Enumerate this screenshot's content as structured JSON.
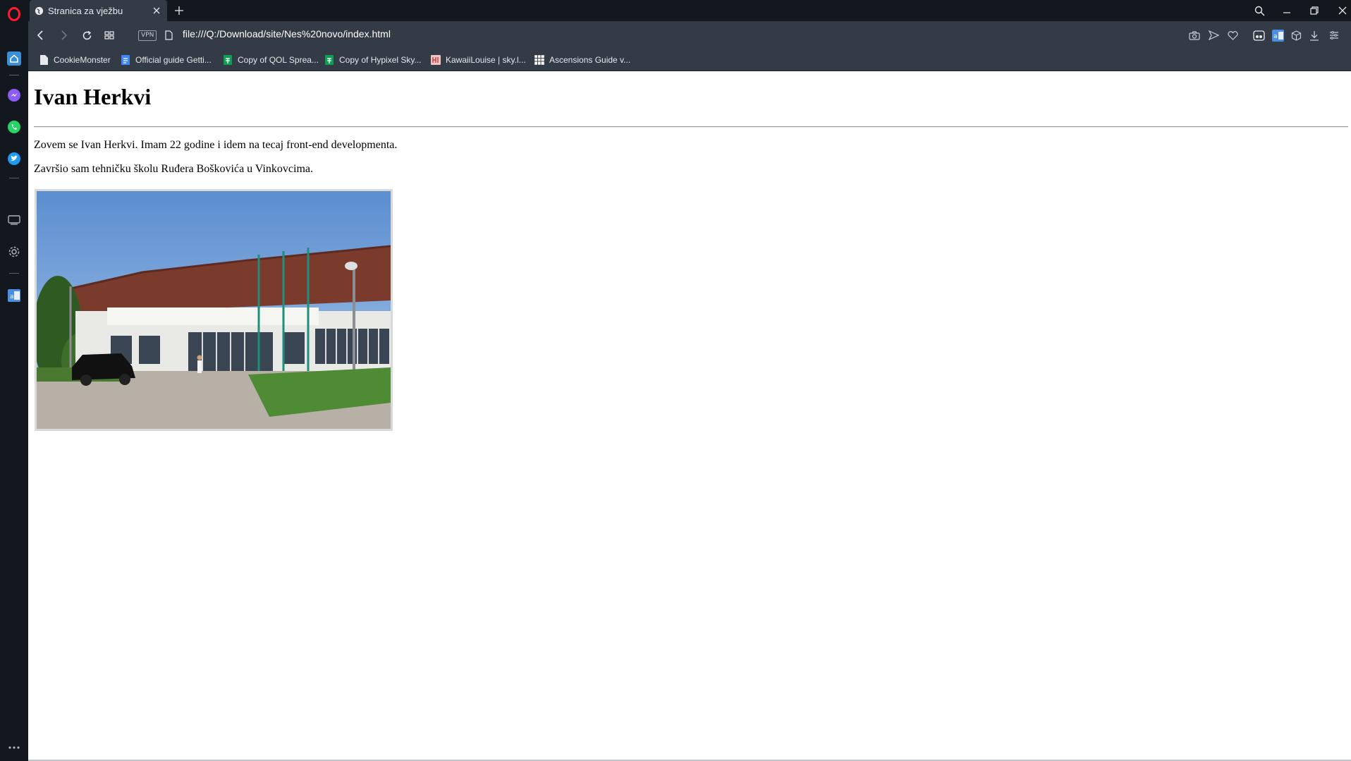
{
  "tab": {
    "title": "Stranica za vježbu"
  },
  "toolbar": {
    "vpn_label": "VPN",
    "url": "file:///Q:/Download/site/Nes%20novo/index.html"
  },
  "bookmarks": [
    {
      "label": "CookieMonster",
      "icon": "page-icon"
    },
    {
      "label": "Official guide Getti...",
      "icon": "docs-icon"
    },
    {
      "label": "Copy of QOL Sprea...",
      "icon": "sheets-icon"
    },
    {
      "label": "Copy of Hypixel Sky...",
      "icon": "sheets-icon"
    },
    {
      "label": "KawaiiLouise | sky.l...",
      "icon": "site-icon"
    },
    {
      "label": "Ascensions Guide v...",
      "icon": "grid-icon"
    }
  ],
  "page": {
    "heading": "Ivan Herkvi",
    "paragraph_1": "Zovem se Ivan Herkvi. Imam 22 godine i idem na tecaj front-end developmenta.",
    "paragraph_2": "Završio sam tehničku školu Ruđera Boškovića u Vinkovcima.",
    "image": "school-building-photo"
  },
  "colors": {
    "sidebar_bg": "#13181f",
    "toolbar_bg": "#333b46",
    "accent_red": "#ff1b2d"
  }
}
